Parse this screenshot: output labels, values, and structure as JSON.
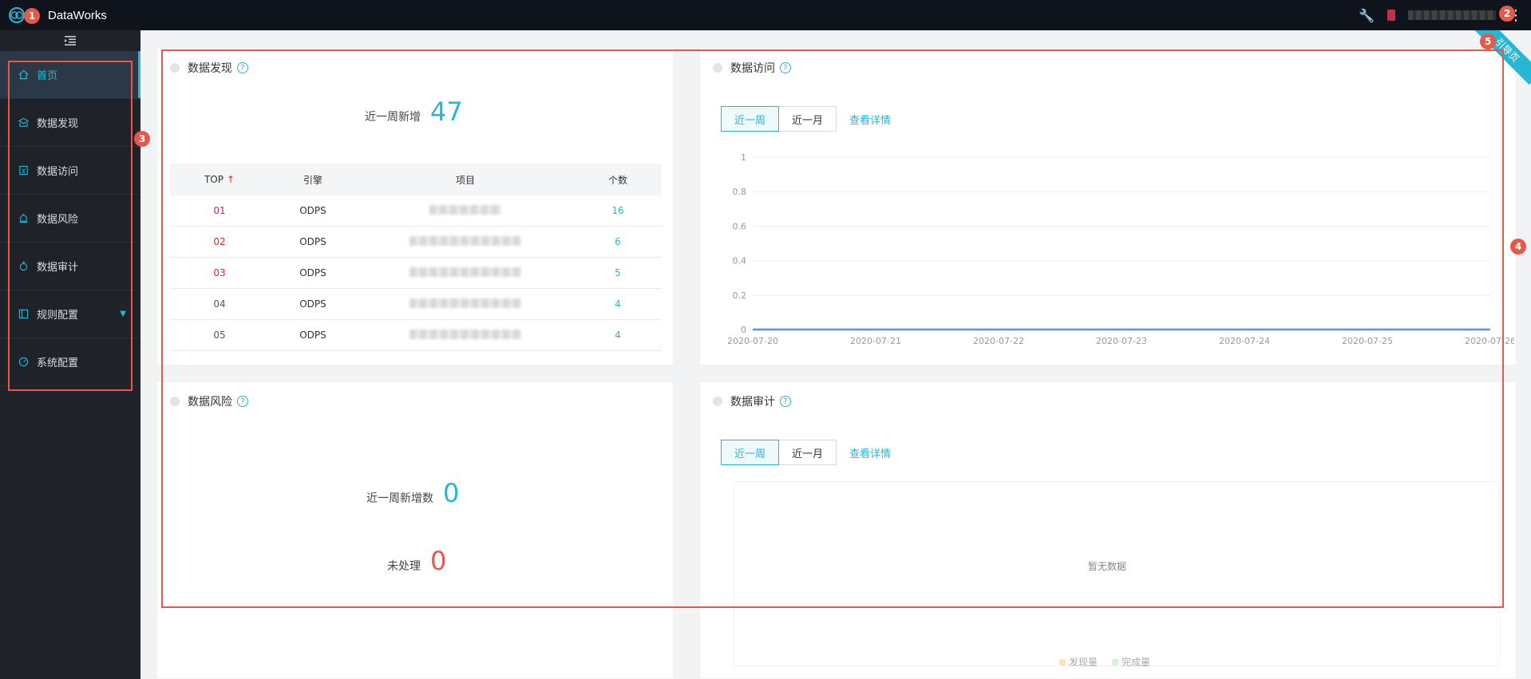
{
  "header": {
    "brand": "DataWorks"
  },
  "sidebar": {
    "items": [
      {
        "label": "首页",
        "icon": "home-icon",
        "active": true
      },
      {
        "label": "数据发现",
        "icon": "discovery-icon"
      },
      {
        "label": "数据访问",
        "icon": "access-icon"
      },
      {
        "label": "数据风险",
        "icon": "alarm-icon"
      },
      {
        "label": "数据审计",
        "icon": "audit-icon"
      },
      {
        "label": "规则配置",
        "icon": "rule-icon",
        "has_submenu": true
      },
      {
        "label": "系统配置",
        "icon": "settings-icon"
      }
    ]
  },
  "discovery": {
    "title": "数据发现",
    "stat_label": "近一周新增",
    "stat_value": "47",
    "columns": [
      "TOP",
      "引擎",
      "项目",
      "个数"
    ],
    "rows": [
      {
        "rank": "01",
        "engine": "ODPS",
        "count": "16"
      },
      {
        "rank": "02",
        "engine": "ODPS",
        "count": "6"
      },
      {
        "rank": "03",
        "engine": "ODPS",
        "count": "5"
      },
      {
        "rank": "04",
        "engine": "ODPS",
        "count": "4"
      },
      {
        "rank": "05",
        "engine": "ODPS",
        "count": "4"
      }
    ]
  },
  "access": {
    "title": "数据访问",
    "tab_week": "近一周",
    "tab_month": "近一月",
    "detail_link": "查看详情"
  },
  "risk": {
    "title": "数据风险",
    "new_label": "近一周新增数",
    "new_value": "0",
    "pending_label": "未处理",
    "pending_value": "0"
  },
  "audit": {
    "title": "数据审计",
    "tab_week": "近一周",
    "tab_month": "近一月",
    "detail_link": "查看详情",
    "empty": "暂无数据",
    "legend": [
      "发现量",
      "完成量"
    ]
  },
  "guide_tab": "引导页",
  "annotations": [
    "1",
    "2",
    "3",
    "4",
    "5"
  ],
  "chart_data": {
    "type": "line",
    "x": [
      "2020-07-20",
      "2020-07-21",
      "2020-07-22",
      "2020-07-23",
      "2020-07-24",
      "2020-07-25",
      "2020-07-26"
    ],
    "series": [
      {
        "values": [
          0,
          0,
          0,
          0,
          0,
          0,
          0
        ]
      }
    ],
    "ylim": [
      0,
      1
    ],
    "yticks": [
      "0",
      "0.2",
      "0.4",
      "0.6",
      "0.8",
      "1"
    ],
    "grid": true,
    "color": "#5b8ff9"
  }
}
